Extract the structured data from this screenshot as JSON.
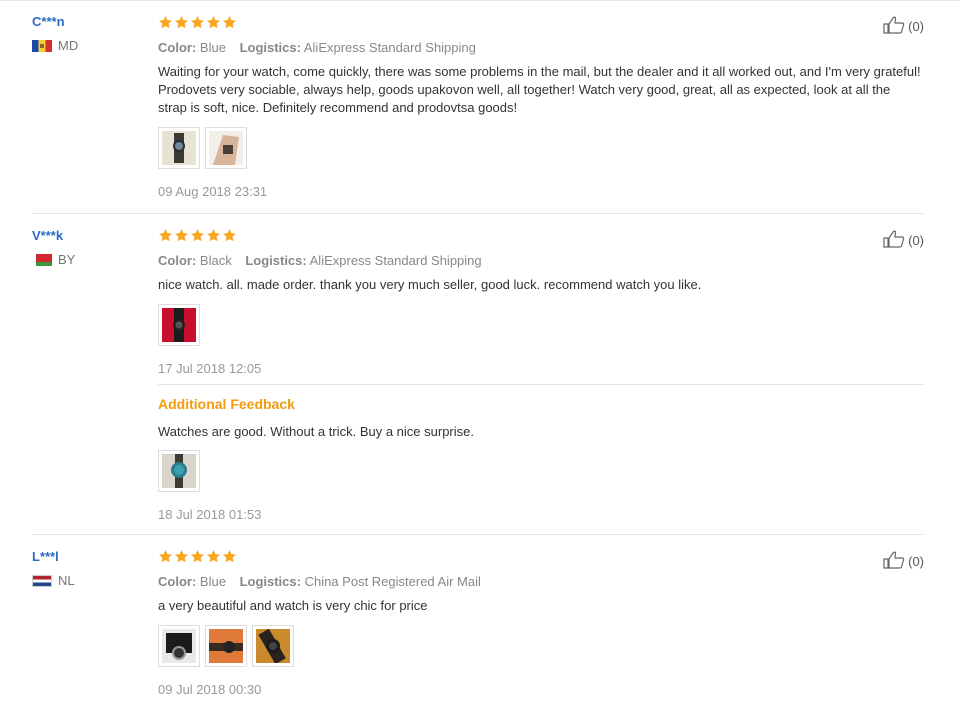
{
  "colors": {
    "username": "#2b6cc4",
    "star": "#f5a623",
    "additional_title": "#f29c0b"
  },
  "reviews": [
    {
      "user": "C***n",
      "country": "MD",
      "flag_icon": "moldova-flag-icon",
      "rating": 5,
      "color_label": "Color:",
      "color_value": "Blue",
      "logistics_label": "Logistics:",
      "logistics_value": "AliExpress Standard Shipping",
      "text": "Waiting for your watch, come quickly, there was some problems in the mail, but the dealer and it all worked out, and I'm very grateful! Prodovets very sociable, always help, goods upakovon well, all together! Watch very good, great, all as expected, look at all the strap is soft, nice. Definitely recommend and prodovtsa goods!",
      "photos": 2,
      "date": "09 Aug 2018 23:31",
      "helpful": "(0)"
    },
    {
      "user": "V***k",
      "country": "BY",
      "flag_icon": "belarus-flag-icon",
      "rating": 5,
      "color_label": "Color:",
      "color_value": "Black",
      "logistics_label": "Logistics:",
      "logistics_value": "AliExpress Standard Shipping",
      "text": "nice watch. all. made order. thank you very much seller, good luck. recommend watch you like.",
      "photos": 1,
      "date": "17 Jul 2018 12:05",
      "helpful": "(0)",
      "additional": {
        "title": "Additional Feedback",
        "text": "Watches are good. Without a trick. Buy a nice surprise.",
        "photos": 1,
        "date": "18 Jul 2018 01:53"
      }
    },
    {
      "user": "L***l",
      "country": "NL",
      "flag_icon": "netherlands-flag-icon",
      "rating": 5,
      "color_label": "Color:",
      "color_value": "Blue",
      "logistics_label": "Logistics:",
      "logistics_value": "China Post Registered Air Mail",
      "text": "a very beautiful and watch is very chic for price",
      "photos": 3,
      "date": "09 Jul 2018 00:30",
      "helpful": "(0)"
    }
  ]
}
